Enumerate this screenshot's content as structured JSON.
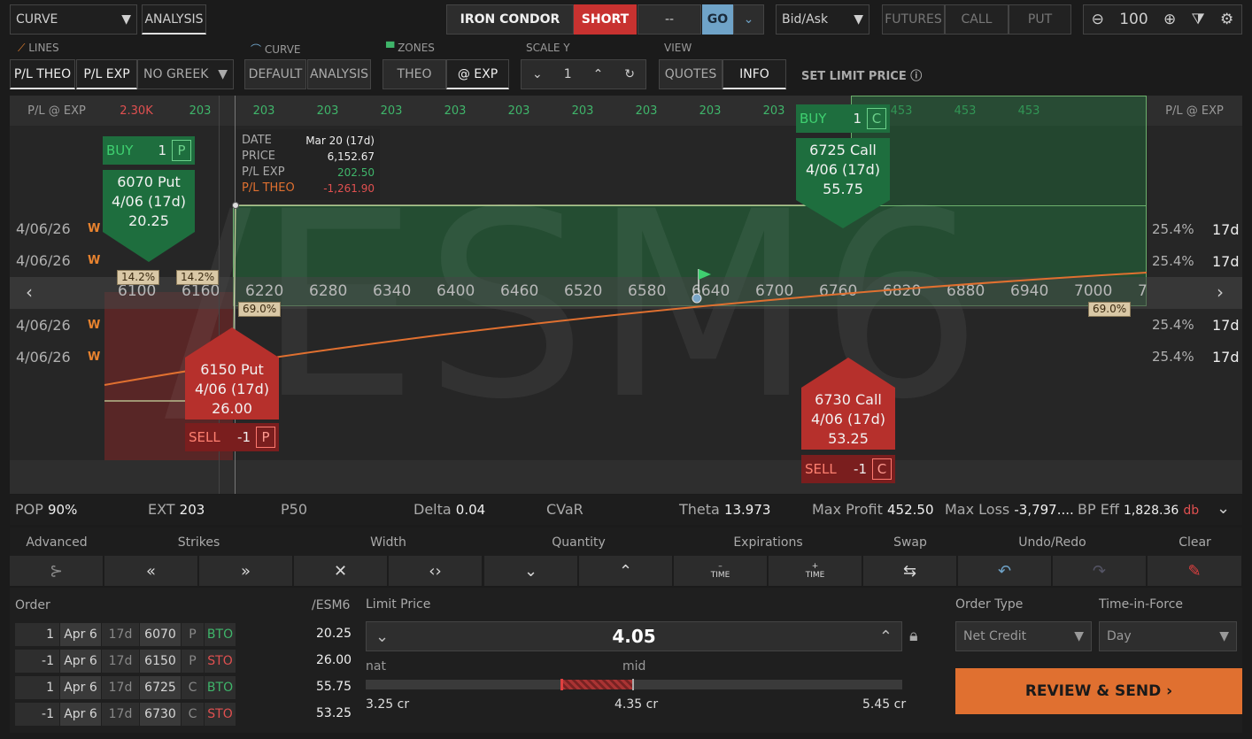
{
  "toolbar": {
    "mode": "CURVE",
    "analysis": "ANALYSIS",
    "strategy": "IRON CONDOR",
    "side": "SHORT",
    "dash": "--",
    "go": "GO",
    "price_type": "Bid/Ask",
    "futures": "FUTURES",
    "call": "CALL",
    "put": "PUT",
    "zoom": "100"
  },
  "lines": {
    "header": "LINES",
    "theo": "P/L THEO",
    "exp": "P/L EXP",
    "greek": "NO GREEK"
  },
  "curve": {
    "header": "CURVE",
    "default": "DEFAULT",
    "analysis": "ANALYSIS"
  },
  "zones": {
    "header": "ZONES",
    "theo": "THEO",
    "exp": "@ EXP"
  },
  "scale": {
    "header": "SCALE Y",
    "value": "1"
  },
  "view": {
    "header": "VIEW",
    "quotes": "QUOTES",
    "info": "INFO"
  },
  "set_limit": "SET LIMIT PRICE",
  "chart": {
    "header_left": "P/L @ EXP",
    "header_right": "P/L @ EXP",
    "header_values": [
      "2.30K",
      "203",
      "203",
      "203",
      "203",
      "203",
      "203",
      "203",
      "203",
      "203",
      "203",
      "453",
      "453",
      "453",
      "453"
    ],
    "x_ticks": [
      "6100",
      "6160",
      "6220",
      "6280",
      "6340",
      "6400",
      "6460",
      "6520",
      "6580",
      "6640",
      "6700",
      "6760",
      "6820",
      "6880",
      "6940",
      "7000",
      "7"
    ],
    "watermark": "/ESM6",
    "pct_left_1": "14.2%",
    "pct_left_2": "14.2%",
    "pct_left_3": "69.0%",
    "pct_right": "69.0%",
    "iv_rows": [
      {
        "date": "4/06/26",
        "w": "W",
        "iv": "25.4%",
        "days": "17d"
      },
      {
        "date": "4/06/26",
        "w": "W",
        "iv": "25.4%",
        "days": "17d"
      },
      {
        "date": "4/06/26",
        "w": "W",
        "iv": "25.4%",
        "days": "17d"
      },
      {
        "date": "4/06/26",
        "w": "W",
        "iv": "25.4%",
        "days": "17d"
      }
    ],
    "tooltip": {
      "date_l": "DATE",
      "date_v": "Mar 20 (17d)",
      "price_l": "PRICE",
      "price_v": "6,152.67",
      "exp_l": "P/L EXP",
      "exp_v": "202.50",
      "theo_l": "P/L THEO",
      "theo_v": "-1,261.90"
    },
    "buy_put": {
      "action": "BUY",
      "qty": "1",
      "type": "P",
      "strike": "6070 Put",
      "exp": "4/06 (17d)",
      "price": "20.25"
    },
    "buy_call": {
      "action": "BUY",
      "qty": "1",
      "type": "C",
      "strike": "6725 Call",
      "exp": "4/06 (17d)",
      "price": "55.75"
    },
    "sell_put": {
      "action": "SELL",
      "qty": "-1",
      "type": "P",
      "strike": "6150 Put",
      "exp": "4/06 (17d)",
      "price": "26.00"
    },
    "sell_call": {
      "action": "SELL",
      "qty": "-1",
      "type": "C",
      "strike": "6730 Call",
      "exp": "4/06 (17d)",
      "price": "53.25"
    }
  },
  "stats": {
    "pop_l": "POP",
    "pop_v": "90%",
    "ext_l": "EXT",
    "ext_v": "203",
    "p50_l": "P50",
    "delta_l": "Delta",
    "delta_v": "0.04",
    "cvar_l": "CVaR",
    "theta_l": "Theta",
    "theta_v": "13.973",
    "maxp_l": "Max Profit",
    "maxp_v": "452.50",
    "maxl_l": "Max Loss",
    "maxl_v": "-3,797....",
    "bp_l": "BP Eff",
    "bp_v": "1,828.36",
    "bp_u": "db"
  },
  "controls": {
    "advanced": "Advanced",
    "strikes": "Strikes",
    "width": "Width",
    "quantity": "Quantity",
    "expirations": "Expirations",
    "swap": "Swap",
    "undo": "Undo/Redo",
    "clear": "Clear",
    "time": "TIME"
  },
  "order": {
    "header": "Order",
    "symbol": "/ESM6",
    "rows": [
      {
        "qty": "1",
        "date": "Apr 6",
        "days": "17d",
        "strike": "6070",
        "type": "P",
        "action": "BTO",
        "price": "20.25"
      },
      {
        "qty": "-1",
        "date": "Apr 6",
        "days": "17d",
        "strike": "6150",
        "type": "P",
        "action": "STO",
        "price": "26.00"
      },
      {
        "qty": "1",
        "date": "Apr 6",
        "days": "17d",
        "strike": "6725",
        "type": "C",
        "action": "BTO",
        "price": "55.75"
      },
      {
        "qty": "-1",
        "date": "Apr 6",
        "days": "17d",
        "strike": "6730",
        "type": "C",
        "action": "STO",
        "price": "53.25"
      }
    ],
    "limit_label": "Limit Price",
    "limit_value": "4.05",
    "nat": "nat",
    "mid": "mid",
    "low": "3.25 cr",
    "midv": "4.35 cr",
    "high": "5.45 cr",
    "order_type_label": "Order Type",
    "order_type": "Net Credit",
    "tif_label": "Time-in-Force",
    "tif": "Day",
    "review": "REVIEW & SEND"
  },
  "colors": {
    "green": "#1e6e3e",
    "red": "#b6302c",
    "orange": "#e07030",
    "go": "#6fa3c8",
    "short": "#c83230"
  }
}
